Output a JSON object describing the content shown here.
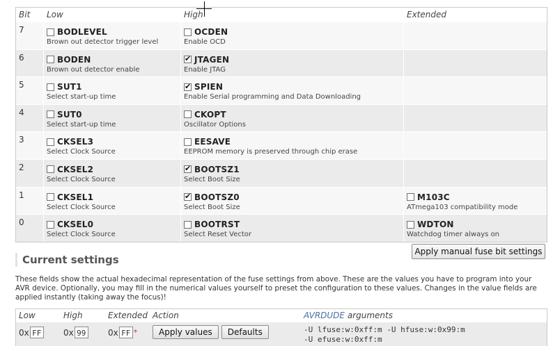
{
  "header": {
    "bit": "Bit",
    "low": "Low",
    "high": "High",
    "ext": "Extended"
  },
  "rows": [
    {
      "bit": "7",
      "low": {
        "name": "BODLEVEL",
        "desc": "Brown out detector trigger level",
        "checked": false
      },
      "high": {
        "name": "OCDEN",
        "desc": "Enable OCD",
        "checked": false
      },
      "ext": null
    },
    {
      "bit": "6",
      "low": {
        "name": "BODEN",
        "desc": "Brown out detector enable",
        "checked": false
      },
      "high": {
        "name": "JTAGEN",
        "desc": "Enable JTAG",
        "checked": true
      },
      "ext": null
    },
    {
      "bit": "5",
      "low": {
        "name": "SUT1",
        "desc": "Select start-up time",
        "checked": false
      },
      "high": {
        "name": "SPIEN",
        "desc": "Enable Serial programming and Data Downloading",
        "checked": true
      },
      "ext": null
    },
    {
      "bit": "4",
      "low": {
        "name": "SUT0",
        "desc": "Select start-up time",
        "checked": false
      },
      "high": {
        "name": "CKOPT",
        "desc": "Oscillator Options",
        "checked": false
      },
      "ext": null
    },
    {
      "bit": "3",
      "low": {
        "name": "CKSEL3",
        "desc": "Select Clock Source",
        "checked": false
      },
      "high": {
        "name": "EESAVE",
        "desc": "EEPROM memory is preserved through chip erase",
        "checked": false
      },
      "ext": null
    },
    {
      "bit": "2",
      "low": {
        "name": "CKSEL2",
        "desc": "Select Clock Source",
        "checked": false
      },
      "high": {
        "name": "BOOTSZ1",
        "desc": "Select Boot Size",
        "checked": true
      },
      "ext": null
    },
    {
      "bit": "1",
      "low": {
        "name": "CKSEL1",
        "desc": "Select Clock Source",
        "checked": false
      },
      "high": {
        "name": "BOOTSZ0",
        "desc": "Select Boot Size",
        "checked": true
      },
      "ext": {
        "name": "M103C",
        "desc": "ATmega103 compatibility mode",
        "checked": false
      }
    },
    {
      "bit": "0",
      "low": {
        "name": "CKSEL0",
        "desc": "Select Clock Source",
        "checked": false
      },
      "high": {
        "name": "BOOTRST",
        "desc": "Select Reset Vector",
        "checked": false
      },
      "ext": {
        "name": "WDTON",
        "desc": "Watchdog timer always on",
        "checked": false
      }
    }
  ],
  "apply_manual_label": "Apply manual fuse bit settings",
  "current": {
    "title": "Current settings",
    "description": "These fields show the actual hexadecimal representation of the fuse settings from above. These are the values you have to program into your AVR device. Optionally, you may fill in the numerical values yourself to preset the configuration to these values. Changes in the value fields are applied instantly (taking away the focus)!",
    "headers": {
      "low": "Low",
      "high": "High",
      "ext": "Extended",
      "action": "Action",
      "avrdude_em": "AVRDUDE",
      "avrdude_rest": " arguments"
    },
    "prefix": "0x",
    "low_value": "FF",
    "high_value": "99",
    "ext_value": "FF",
    "ext_mark": "*",
    "apply_values_label": "Apply values",
    "defaults_label": "Defaults",
    "avrdude_line1": "-U lfuse:w:0xff:m -U hfuse:w:0x99:m",
    "avrdude_line2": "-U efuse:w:0xff:m"
  }
}
